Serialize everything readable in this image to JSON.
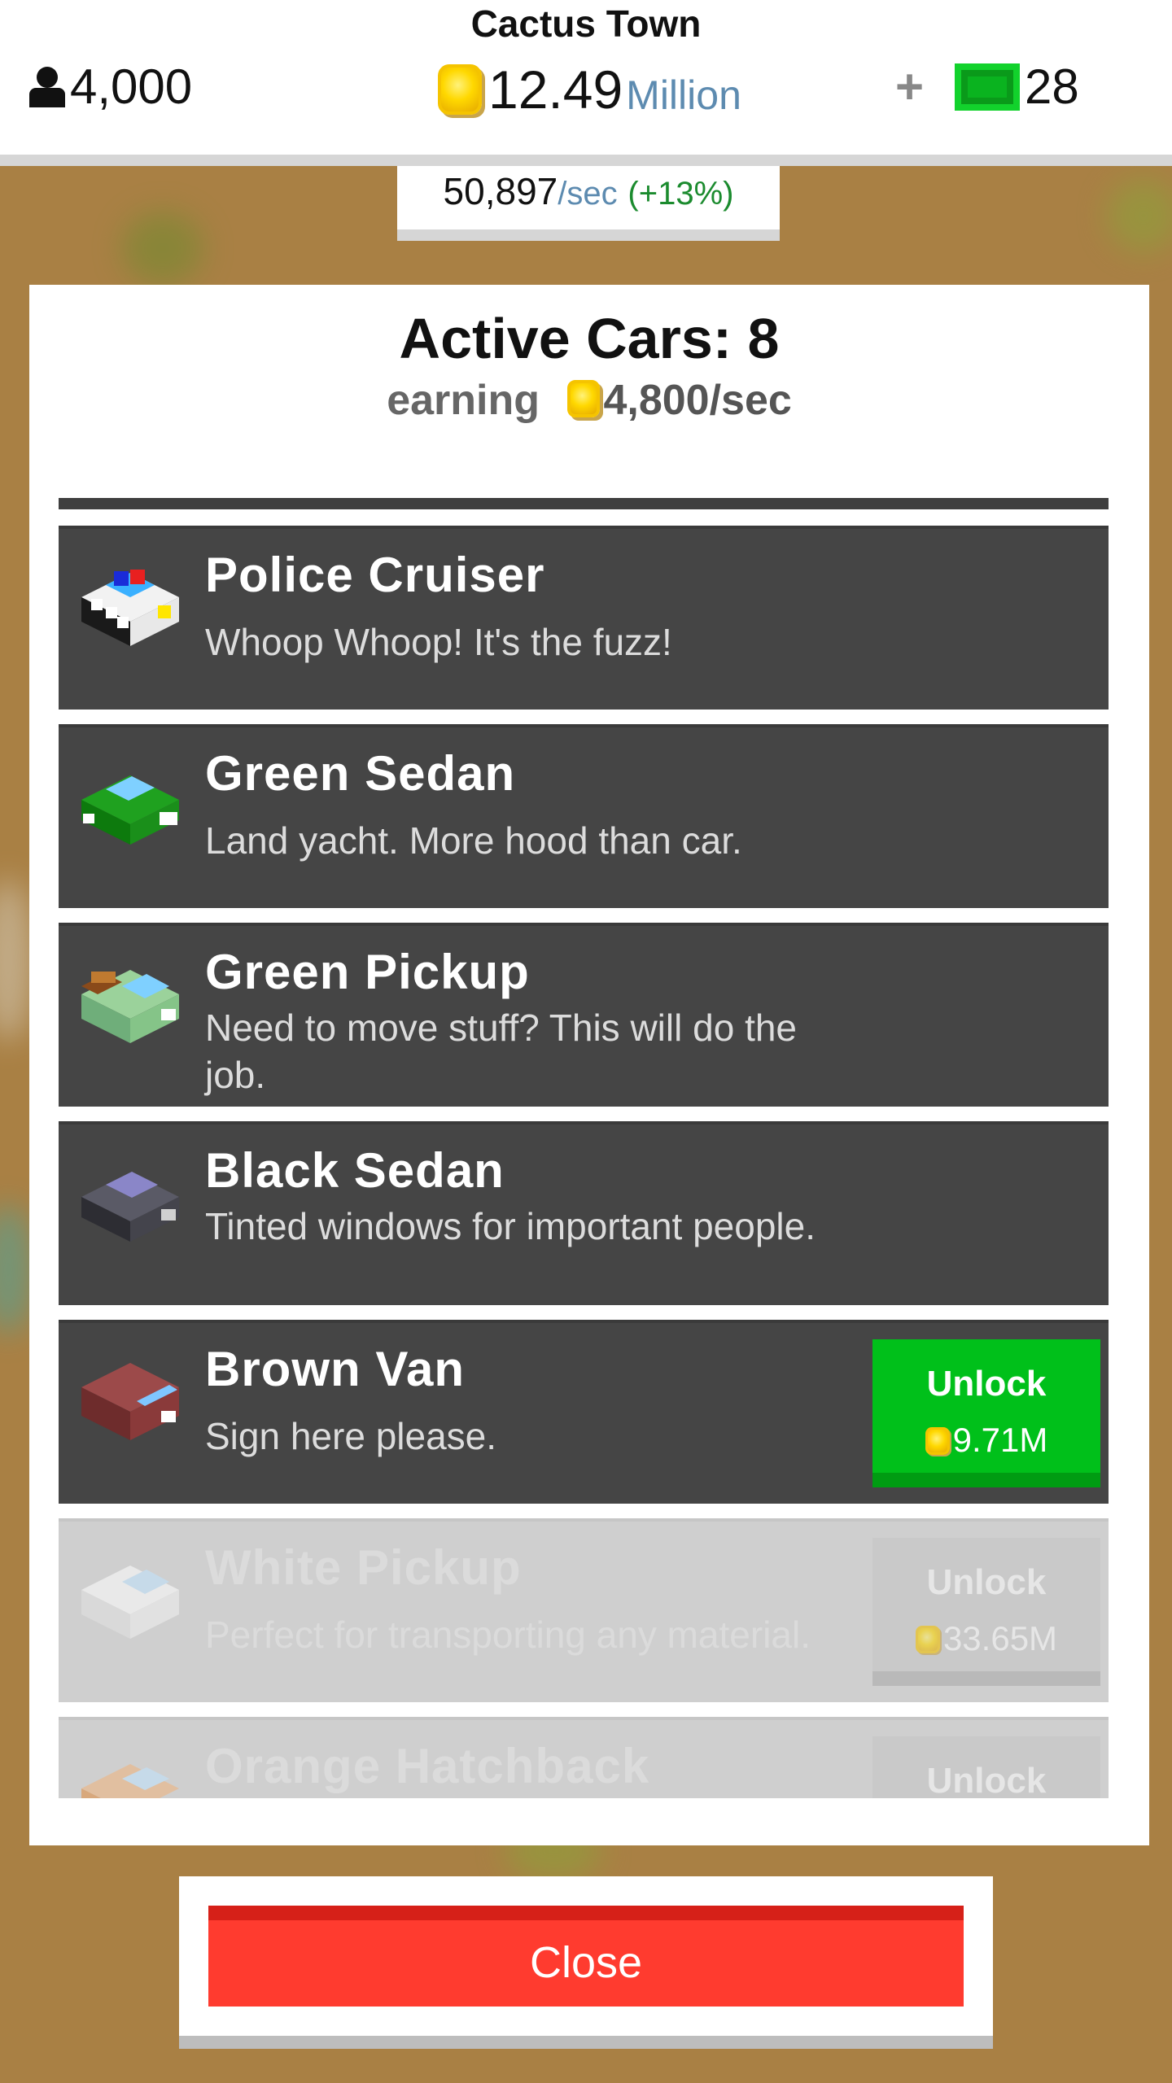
{
  "header": {
    "town_name": "Cactus Town",
    "population": "4,000",
    "money_value": "12.49",
    "money_unit": "Million",
    "plus": "+",
    "cash": "28",
    "rate_value": "50,897",
    "rate_unit": "/sec",
    "rate_bonus": "(+13%)"
  },
  "panel": {
    "title": "Active Cars: 8",
    "earning_label": "earning",
    "earning_value": "4,800/sec"
  },
  "cars": [
    {
      "name": "Police Cruiser",
      "desc": "Whoop Whoop! It's the fuzz!",
      "locked": false
    },
    {
      "name": "Green Sedan",
      "desc": "Land yacht. More hood than car.",
      "locked": false
    },
    {
      "name": "Green Pickup",
      "desc": "Need to move stuff? This will do the job.",
      "locked": false
    },
    {
      "name": "Black Sedan",
      "desc": "Tinted windows for important people.",
      "locked": false
    },
    {
      "name": "Brown Van",
      "desc": "Sign here please.",
      "unlock_label": "Unlock",
      "price": "9.71M",
      "locked": false
    },
    {
      "name": "White Pickup",
      "desc": "Perfect for transporting any material.",
      "unlock_label": "Unlock",
      "price": "33.65M",
      "locked": true
    },
    {
      "name": "Orange Hatchback",
      "desc": "",
      "unlock_label": "Unlock",
      "price": "",
      "locked": true
    }
  ],
  "close_label": "Close",
  "colors": {
    "background": "#a98044",
    "row_dark": "#454545",
    "unlock_green": "#00c01a",
    "close_red": "#ff3b2f",
    "coin_yellow": "#ffd800",
    "cash_green": "#0ab31f"
  },
  "icons": [
    "person-icon",
    "coin-icon",
    "cash-icon",
    "car-icons"
  ]
}
